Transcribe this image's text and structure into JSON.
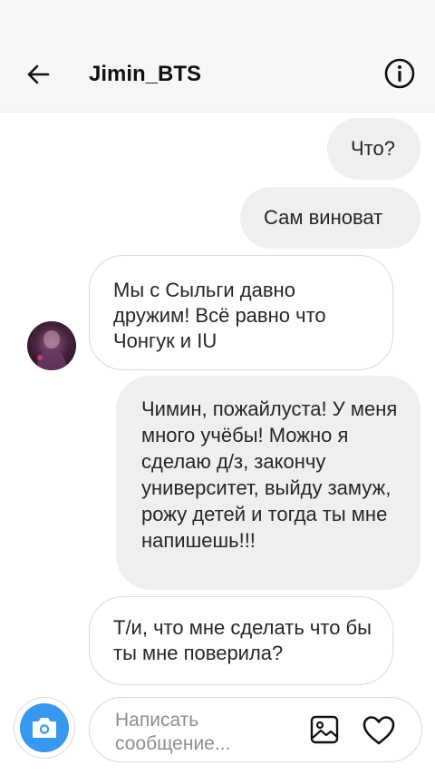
{
  "header": {
    "title": "Jimin_BTS"
  },
  "messages": [
    {
      "side": "sent",
      "text": "Что?"
    },
    {
      "side": "sent",
      "text": "Сам виноват"
    },
    {
      "side": "received",
      "text": "Мы с Сыльги давно дружим! Всё равно что Чонгук и IU"
    },
    {
      "side": "sent",
      "text": "Чимин, пожайлуста! У меня много учёбы! Можно я сделаю д/з, закончу университет, выйду замуж, рожу детей и тогда ты мне напишешь!!!"
    },
    {
      "side": "received",
      "text": "Т/и, что мне сделать что бы ты мне поверила?"
    }
  ],
  "composer": {
    "placeholder": "Написать сообщение..."
  },
  "icons": {
    "back": "arrow-left-icon",
    "info": "info-icon",
    "camera": "camera-icon",
    "gallery": "image-icon",
    "like": "heart-icon"
  },
  "colors": {
    "accent": "#3897f0",
    "sent_bubble": "#efefef",
    "received_border": "#dbdbdb"
  }
}
